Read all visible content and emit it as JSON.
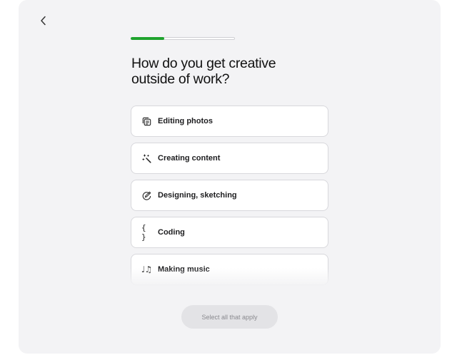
{
  "header": {
    "back_icon": "chevron-left-icon"
  },
  "progress": {
    "value_fraction": 0.32,
    "color": "#1fa32d"
  },
  "question": {
    "title_line1": "How do you get creative",
    "title_line2": "outside of work?"
  },
  "options": [
    {
      "label": "Editing photos",
      "icon": "photos-stack-icon"
    },
    {
      "label": "Creating content",
      "icon": "magic-wand-icon"
    },
    {
      "label": "Designing, sketching",
      "icon": "pencil-circle-icon"
    },
    {
      "label": "Coding",
      "icon": "curly-braces-icon",
      "glyph": "{ }"
    },
    {
      "label": "Making music",
      "icon": "music-notes-icon",
      "glyph": "♩♫"
    }
  ],
  "footer": {
    "button_label": "Select all that apply"
  }
}
